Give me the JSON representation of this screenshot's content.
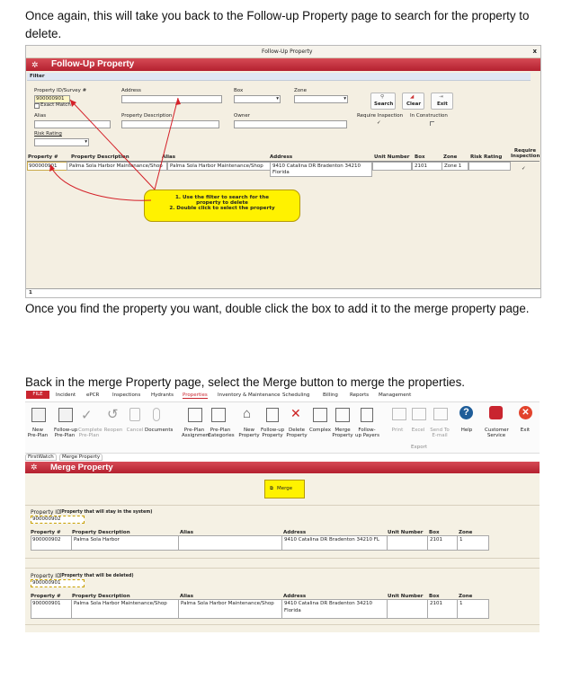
{
  "paragraphs": {
    "p1": "Once again, this will take you back to the Follow-up Property page to search for the property to delete.",
    "p2": "Once you find the property you want, double click the box to add it to the merge property page.",
    "p3": "Back in the merge Property page, select the Merge button to merge the properties."
  },
  "shot1": {
    "window_title": "Follow-Up Property",
    "close_glyph": "x",
    "header": "Follow-Up Property",
    "filter_label": "Filter",
    "labels": {
      "property_id": "Property ID/Survey #",
      "exact_match": "Exact Match",
      "address": "Address",
      "box": "Box",
      "zone": "Zone",
      "alias": "Alias",
      "property_description": "Property Description",
      "owner": "Owner",
      "require_inspection": "Require Inspection",
      "in_construction": "In Construction",
      "risk_rating": "Risk Rating"
    },
    "property_id_value": "900000901",
    "buttons": {
      "search": "Search",
      "clear": "Clear",
      "exit": "Exit"
    },
    "columns": [
      "Property #",
      "Property Description",
      "Alias",
      "Address",
      "Unit Number",
      "Box",
      "Zone",
      "Risk Rating",
      "Require Inspection"
    ],
    "row": {
      "property": "900000901",
      "description": "Palma Sola Harbor Maintenance/Shop",
      "alias": "Palma Sola Harbor Maintenance/Shop",
      "address_line1": "9410 Catalina DR Bradenton 34210",
      "address_line2": "Florida",
      "box": "2101",
      "zone": "Zone 1",
      "check": "✓"
    },
    "callout": {
      "line1": "1. Use the filter to search for the",
      "line2": "property to delete",
      "line3": "2. Double click to select the property"
    },
    "status_count": "1"
  },
  "shot2": {
    "menu": [
      "FILE",
      "Incident",
      "ePCR",
      "Inspections",
      "Hydrants",
      "Properties",
      "Inventory & Maintenance",
      "Scheduling",
      "Billing",
      "Reports",
      "Management"
    ],
    "toolbar": [
      {
        "l1": "New",
        "l2": "Pre-Plan"
      },
      {
        "l1": "Follow-up",
        "l2": "Pre-Plan"
      },
      {
        "l1": "Complete",
        "l2": "Pre-Plan"
      },
      {
        "l1": "Reopen",
        "l2": ""
      },
      {
        "l1": "Cancel",
        "l2": ""
      },
      {
        "l1": "Documents",
        "l2": ""
      },
      {
        "l1": "Pre-Plan",
        "l2": "Assignment"
      },
      {
        "l1": "Pre-Plan",
        "l2": "Categories"
      },
      {
        "l1": "New",
        "l2": "Property"
      },
      {
        "l1": "Follow-up",
        "l2": "Property"
      },
      {
        "l1": "Delete",
        "l2": "Property"
      },
      {
        "l1": "Complex",
        "l2": ""
      },
      {
        "l1": "Merge",
        "l2": "Property"
      },
      {
        "l1": "Follow-",
        "l2": "up Payers"
      },
      {
        "l1": "Print",
        "l2": ""
      },
      {
        "l1": "Excel",
        "l2": ""
      },
      {
        "l1": "Send To",
        "l2": "E-mail"
      },
      {
        "l1": "Help",
        "l2": ""
      },
      {
        "l1": "Customer",
        "l2": "Service"
      },
      {
        "l1": "Exit",
        "l2": ""
      }
    ],
    "export_label": "Export",
    "tabs": [
      "FirstWatch",
      "Merge Property"
    ],
    "header": "Merge Property",
    "merge_button": "Merge",
    "stay": {
      "label": "Property ID",
      "note": "(Property that will stay in the system)",
      "id": "900000902",
      "columns": [
        "Property #",
        "Property Description",
        "Alias",
        "Address",
        "Unit Number",
        "Box",
        "Zone"
      ],
      "row": {
        "property": "900000902",
        "description": "Palma Sola Harbor",
        "alias": "",
        "address_line1": "9410 Catalina DR Bradenton 34210 FL",
        "address_line2": "",
        "unit": "",
        "box": "2101",
        "zone": "1"
      }
    },
    "del": {
      "label": "Property ID",
      "note": "(Property that will be deleted)",
      "id": "900000901",
      "columns": [
        "Property #",
        "Property Description",
        "Alias",
        "Address",
        "Unit Number",
        "Box",
        "Zone"
      ],
      "row": {
        "property": "900000901",
        "description": "Palma Sola Harbor Maintenance/Shop",
        "alias": "Palma Sola Harbor Maintenance/Shop",
        "address_line1": "9410 Catalina DR Bradenton 34210",
        "address_line2": "Florida",
        "unit": "",
        "box": "2101",
        "zone": "1"
      }
    }
  }
}
